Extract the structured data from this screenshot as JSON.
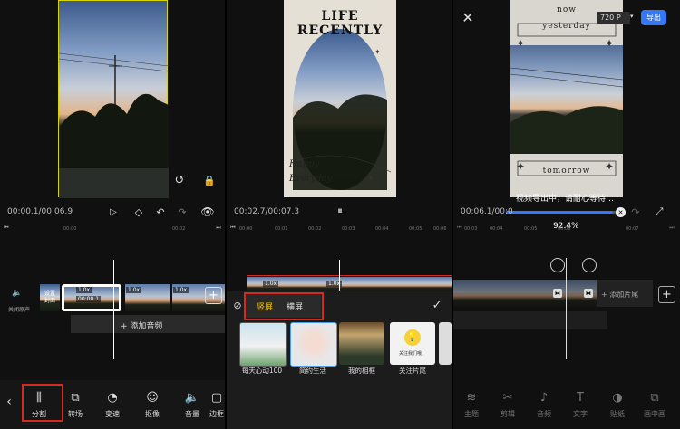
{
  "panel1": {
    "time": "00:00.1/00:06.9",
    "ticks": [
      "00:00",
      "00:02"
    ],
    "track_labels": [
      "关闭原声"
    ],
    "clip_labels": [
      "设置封面"
    ],
    "clip_badges": [
      "1.0x",
      "1.0x",
      "1.0x"
    ],
    "clip_duration": "00:00.1",
    "add_audio": "+ 添加音频",
    "tools": [
      "分割",
      "转场",
      "变速",
      "抠像",
      "音量",
      "边框"
    ]
  },
  "panel2": {
    "time": "00:02.7/00:07.3",
    "title_text": "LIFE RECENTLY",
    "script_text": "Happy Everyday",
    "ticks": [
      "00:00",
      "00:01",
      "00:02",
      "00:03",
      "00:04",
      "00:05",
      "00:06"
    ],
    "clip_badges": [
      "1.0x",
      "1.0x"
    ],
    "orientation_tabs": [
      "竖屏",
      "横屏"
    ],
    "templates": [
      "每天心动100",
      "简约生活",
      "我的相框",
      "关注片尾"
    ],
    "badge_text": "关注我们哦！"
  },
  "panel3": {
    "time": "00:06.1/00:0",
    "resolution": "720 P",
    "export_label": "导出",
    "overlay_top1": "now",
    "overlay_top2": "yesterday",
    "overlay_bottom": "tomorrow",
    "exporting_text": "视频导出中，请耐心等待…",
    "progress_text": "92.4%",
    "progress_value": 0.924,
    "ticks": [
      "00:03",
      "00:04",
      "00:05",
      "00:06",
      "00:07"
    ],
    "add_ending": "+ 添加片尾",
    "bottom_tabs": [
      "主题",
      "剪辑",
      "音频",
      "文字",
      "贴纸",
      "画中画"
    ]
  },
  "colors": {
    "accent_yellow": "#f5c400",
    "highlight_red": "#d42a20",
    "export_blue": "#3478f6"
  }
}
